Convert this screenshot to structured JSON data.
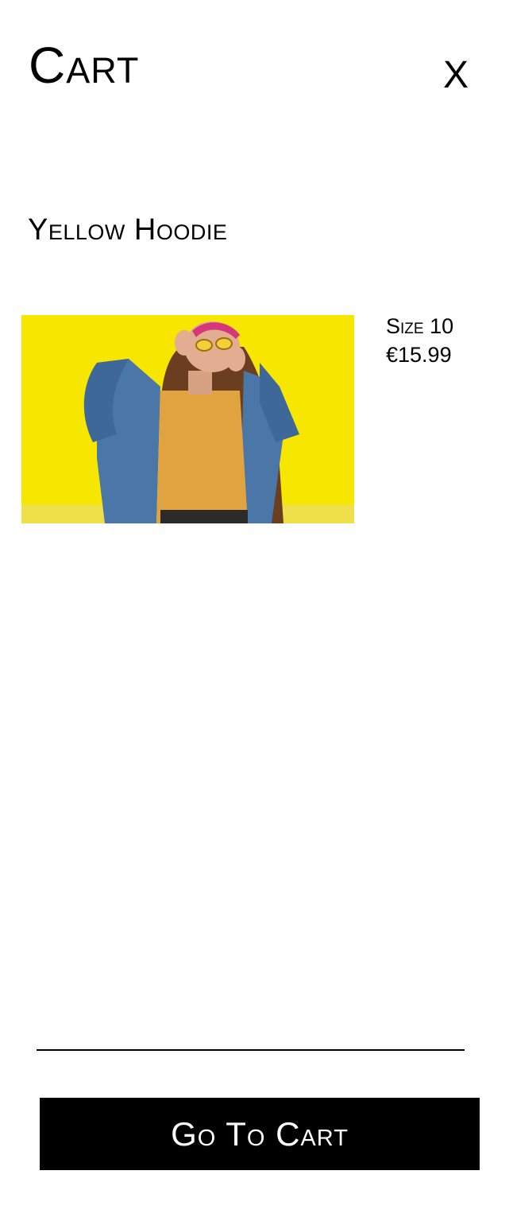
{
  "header": {
    "title": "Cart",
    "close_label": "X"
  },
  "item": {
    "name": "Yellow Hoodie",
    "size": "Size 10",
    "price": "€15.99",
    "image_icon": "product-photo"
  },
  "footer": {
    "go_to_cart_label": "Go To Cart"
  },
  "colors": {
    "background": "#ffffff",
    "text": "#000000",
    "button_bg": "#000000",
    "button_text": "#ffffff",
    "image_background": "#f7e600"
  }
}
